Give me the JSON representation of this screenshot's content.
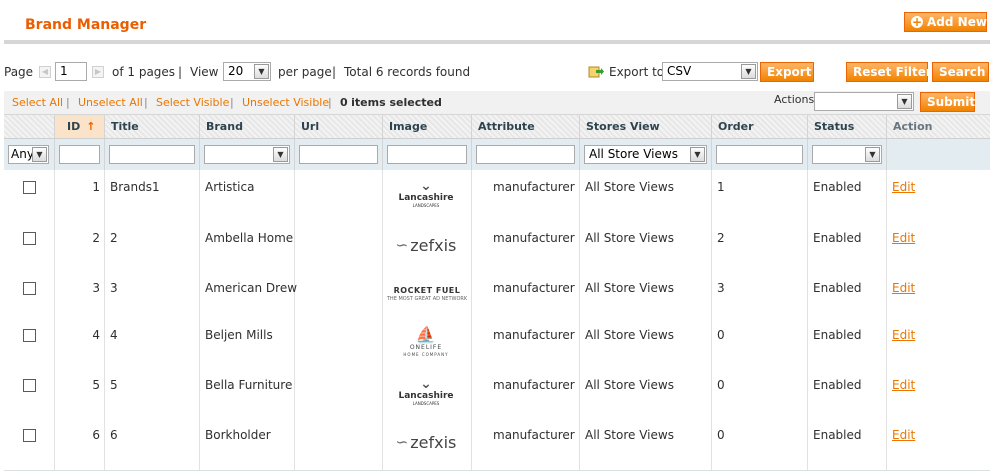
{
  "header": {
    "title": "Brand Manager",
    "add_button": "Add New"
  },
  "pager": {
    "page_label": "Page",
    "page_value": "1",
    "of_pages": "of 1 pages",
    "view_label": "View",
    "view_value": "20",
    "per_page": "per page",
    "total": "Total 6 records found",
    "export_label": "Export to:",
    "export_value": "CSV",
    "export_button": "Export",
    "reset_button": "Reset Filter",
    "search_button": "Search"
  },
  "massaction": {
    "select_all": "Select All",
    "unselect_all": "Unselect All",
    "select_visible": "Select Visible",
    "unselect_visible": "Unselect Visible",
    "selected_count": "0",
    "selected_suffix": "items selected",
    "actions_label": "Actions",
    "actions_value": "",
    "submit_button": "Submit"
  },
  "columns": [
    "",
    "ID",
    "Title",
    "Brand",
    "Url",
    "Image",
    "Attribute",
    "Stores View",
    "Order",
    "Status",
    "Action"
  ],
  "filters": {
    "checkbox": "Any",
    "stores_view": "All Store Views"
  },
  "rows": [
    {
      "id": "1",
      "title": "Brands1",
      "brand": "Artistica",
      "url": "",
      "image": "lancashire",
      "attribute": "manufacturer",
      "stores": "All Store Views",
      "order": "1",
      "status": "Enabled",
      "action": "Edit"
    },
    {
      "id": "2",
      "title": "2",
      "brand": "Ambella Home",
      "url": "",
      "image": "zefxis",
      "attribute": "manufacturer",
      "stores": "All Store Views",
      "order": "2",
      "status": "Enabled",
      "action": "Edit"
    },
    {
      "id": "3",
      "title": "3",
      "brand": "American Drew",
      "url": "",
      "image": "rocketfuel",
      "attribute": "manufacturer",
      "stores": "All Store Views",
      "order": "3",
      "status": "Enabled",
      "action": "Edit"
    },
    {
      "id": "4",
      "title": "4",
      "brand": "Beljen Mills",
      "url": "",
      "image": "onelife",
      "attribute": "manufacturer",
      "stores": "All Store Views",
      "order": "0",
      "status": "Enabled",
      "action": "Edit"
    },
    {
      "id": "5",
      "title": "5",
      "brand": "Bella Furniture",
      "url": "",
      "image": "lancashire",
      "attribute": "manufacturer",
      "stores": "All Store Views",
      "order": "0",
      "status": "Enabled",
      "action": "Edit"
    },
    {
      "id": "6",
      "title": "6",
      "brand": "Borkholder",
      "url": "",
      "image": "zefxis",
      "attribute": "manufacturer",
      "stores": "All Store Views",
      "order": "0",
      "status": "Enabled",
      "action": "Edit"
    }
  ],
  "logos": {
    "lancashire": {
      "name": "Lancashire",
      "tagline": "LANDSCAPES",
      "icon": "bird-icon"
    },
    "zefxis": {
      "name": "zefxis",
      "icon": "swan-icon"
    },
    "rocketfuel": {
      "name": "ROCKET FUEL",
      "tagline": "THE MOST GREAT AD NETWORK",
      "icon": "rocket-icon"
    },
    "onelife": {
      "name": "ONELIFE",
      "tagline": "HOME COMPANY",
      "icon": "ship-icon"
    }
  },
  "colors": {
    "accent": "#eb5e00",
    "link": "#ea7601",
    "button": "#f18200"
  }
}
